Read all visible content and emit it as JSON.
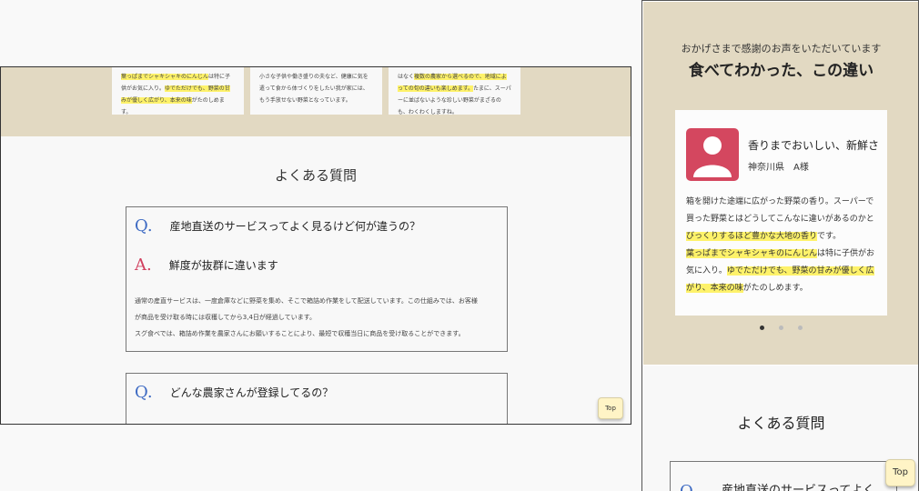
{
  "desktop": {
    "cards": [
      {
        "pre": "",
        "hl1": "葉っぱまでシャキシャキのにんじん",
        "mid": "は特に子供がお気に入り。",
        "hl2": "ゆでただけでも、野菜の甘みが優しく広がり、本来の味",
        "post": "がたのしめます。"
      },
      {
        "pre": "小さな子供や働き盛りの夫など、健康に気を遣って食から体づくりをしたい我が家には、もう手放せない野菜となっています。",
        "hl1": "",
        "mid": "",
        "hl2": "",
        "post": ""
      },
      {
        "pre": "はなく",
        "hl1": "複数の農家から選べるので、地域によっての旬の違いも楽しめます。",
        "mid": "たまに、スーパーに並ばないような珍しい野菜がまざるのも、わくわくしますね。",
        "hl2": "",
        "post": ""
      }
    ],
    "faq_title": "よくある質問",
    "faq": [
      {
        "q_mark": "Q.",
        "question": "産地直送のサービスってよく見るけど何が違うの？",
        "a_mark": "A.",
        "answer": "鮮度が抜群に違います",
        "body1": "通常の産直サービスは、一度倉庫などに野菜を集め、そこで箱詰め作業をして配送しています。この仕組みでは、お客様",
        "body2": "が商品を受け取る時には収穫してから3,4日が経過しています。",
        "body3": "スグ食べでは、箱詰め作業を農家さんにお願いすることにより、最短で収穫当日に商品を受け取ることができます。"
      },
      {
        "q_mark": "Q.",
        "question": "どんな農家さんが登録してるの？"
      }
    ],
    "top_label": "Top"
  },
  "mobile": {
    "subtitle": "おかげさまで感謝のお声をいただいています",
    "title": "食べてわかった、この違い",
    "card": {
      "title": "香りまでおいしい、新鮮さ",
      "author": "神奈川県　A様",
      "t1": "箱を開けた途端に広がった野菜の香り。スーパーで買った野菜とはどうしてこんなに違いがあるのかと",
      "h1": "びっくりするほど豊かな大地の香り",
      "t2": "です。",
      "h2": "葉っぱまでシャキシャキのにんじん",
      "t3": "は特に子供がお気に入り。",
      "h3": "ゆでただけでも、野菜の甘みが優しく広がり、本来の味",
      "t4": "がたのしめます。"
    },
    "dots_active": 0,
    "faq_title": "よくある質問",
    "faq_q_mark": "Q.",
    "faq_question": "産地直送のサービスってよく",
    "top_label": "Top"
  },
  "colors": {
    "band": "#e2d9c2",
    "highlight": "#fef26a",
    "q_blue": "#3d6ac3",
    "a_red": "#d1405f",
    "avatar": "#d4475f",
    "top_button": "#fff4c6"
  },
  "icons": {
    "avatar": "person-avatar-icon"
  }
}
